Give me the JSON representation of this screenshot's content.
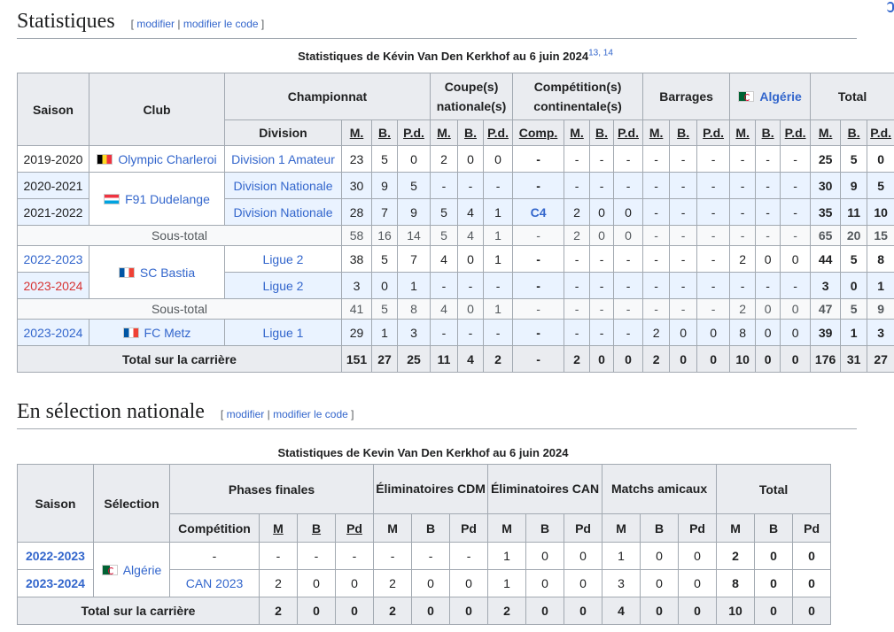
{
  "section1": {
    "heading": "Statistiques",
    "edit_open": "[",
    "edit1": "modifier",
    "edit_sep": "|",
    "edit2": "modifier le code",
    "edit_close": "]"
  },
  "club_caption": {
    "text": "Statistiques de Kévin Van Den Kerkhof au 6 juin 2024",
    "refs": "13, 14"
  },
  "club_table": {
    "h_saison": "Saison",
    "h_club": "Club",
    "h_championnat": "Championnat",
    "h_coupes": "Coupe(s) nationale(s)",
    "h_continent": "Compétition(s) continentale(s)",
    "h_barrages": "Barrages",
    "h_algerie": "Algérie",
    "h_total": "Total",
    "h_division": "Division",
    "h_m": "M.",
    "h_b": "B.",
    "h_pd": "P.d.",
    "h_comp": "Comp.",
    "rows": [
      {
        "saison": "2019-2020",
        "club": "Olympic Charleroi",
        "division": "Division 1 Amateur",
        "ch": [
          "23",
          "5",
          "0"
        ],
        "cp": [
          "2",
          "0",
          "0"
        ],
        "comp": "-",
        "ct": [
          "-",
          "-",
          "-"
        ],
        "br": [
          "-",
          "-",
          "-"
        ],
        "dz": [
          "-",
          "-",
          "-"
        ],
        "tot": [
          "25",
          "5",
          "0"
        ]
      },
      {
        "saison": "2020-2021",
        "club": "F91 Dudelange",
        "division": "Division Nationale",
        "ch": [
          "30",
          "9",
          "5"
        ],
        "cp": [
          "-",
          "-",
          "-"
        ],
        "comp": "-",
        "ct": [
          "-",
          "-",
          "-"
        ],
        "br": [
          "-",
          "-",
          "-"
        ],
        "dz": [
          "-",
          "-",
          "-"
        ],
        "tot": [
          "30",
          "9",
          "5"
        ]
      },
      {
        "saison": "2021-2022",
        "division": "Division Nationale",
        "ch": [
          "28",
          "7",
          "9"
        ],
        "cp": [
          "5",
          "4",
          "1"
        ],
        "comp": "C4",
        "ct": [
          "2",
          "0",
          "0"
        ],
        "br": [
          "-",
          "-",
          "-"
        ],
        "dz": [
          "-",
          "-",
          "-"
        ],
        "tot": [
          "35",
          "11",
          "10"
        ]
      },
      {
        "label": "Sous-total",
        "ch": [
          "58",
          "16",
          "14"
        ],
        "cp": [
          "5",
          "4",
          "1"
        ],
        "comp": "-",
        "ct": [
          "2",
          "0",
          "0"
        ],
        "br": [
          "-",
          "-",
          "-"
        ],
        "dz": [
          "-",
          "-",
          "-"
        ],
        "tot": [
          "65",
          "20",
          "15"
        ]
      },
      {
        "saison": "2022-2023",
        "club": "SC Bastia",
        "division": "Ligue 2",
        "ch": [
          "38",
          "5",
          "7"
        ],
        "cp": [
          "4",
          "0",
          "1"
        ],
        "comp": "-",
        "ct": [
          "-",
          "-",
          "-"
        ],
        "br": [
          "-",
          "-",
          "-"
        ],
        "dz": [
          "2",
          "0",
          "0"
        ],
        "tot": [
          "44",
          "5",
          "8"
        ]
      },
      {
        "saison": "2023-2024",
        "division": "Ligue 2",
        "ch": [
          "3",
          "0",
          "1"
        ],
        "cp": [
          "-",
          "-",
          "-"
        ],
        "comp": "-",
        "ct": [
          "-",
          "-",
          "-"
        ],
        "br": [
          "-",
          "-",
          "-"
        ],
        "dz": [
          "-",
          "-",
          "-"
        ],
        "tot": [
          "3",
          "0",
          "1"
        ]
      },
      {
        "label": "Sous-total",
        "ch": [
          "41",
          "5",
          "8"
        ],
        "cp": [
          "4",
          "0",
          "1"
        ],
        "comp": "-",
        "ct": [
          "-",
          "-",
          "-"
        ],
        "br": [
          "-",
          "-",
          "-"
        ],
        "dz": [
          "2",
          "0",
          "0"
        ],
        "tot": [
          "47",
          "5",
          "9"
        ]
      },
      {
        "saison": "2023-2024",
        "club": "FC Metz",
        "division": "Ligue 1",
        "ch": [
          "29",
          "1",
          "3"
        ],
        "cp": [
          "-",
          "-",
          "-"
        ],
        "comp": "-",
        "ct": [
          "-",
          "-",
          "-"
        ],
        "br": [
          "2",
          "0",
          "0"
        ],
        "dz": [
          "8",
          "0",
          "0"
        ],
        "tot": [
          "39",
          "1",
          "3"
        ]
      },
      {
        "label": "Total sur la carrière",
        "ch": [
          "151",
          "27",
          "25"
        ],
        "cp": [
          "11",
          "4",
          "2"
        ],
        "comp": "-",
        "ct": [
          "2",
          "0",
          "0"
        ],
        "br": [
          "2",
          "0",
          "0"
        ],
        "dz": [
          "10",
          "0",
          "0"
        ],
        "tot": [
          "176",
          "31",
          "27"
        ]
      }
    ]
  },
  "section2": {
    "heading": "En sélection nationale",
    "edit_open": "[",
    "edit1": "modifier",
    "edit_sep": "|",
    "edit2": "modifier le code",
    "edit_close": "]"
  },
  "nat_caption": {
    "text": "Statistiques de Kevin Van Den Kerkhof au 6 juin 2024"
  },
  "nat_table": {
    "h_saison": "Saison",
    "h_selection": "Sélection",
    "h_phases": "Phases finales",
    "h_elim_cdm": "Éliminatoires CDM",
    "h_elim_can": "Éliminatoires CAN",
    "h_amicaux": "Matchs amicaux",
    "h_total": "Total",
    "h_competition": "Compétition",
    "h_m": "M",
    "h_b": "B",
    "h_pd": "Pd",
    "selection": "Algérie",
    "rows": [
      {
        "saison": "2022-2023",
        "comp": "-",
        "pf": [
          "-",
          "-",
          "-"
        ],
        "cdm": [
          "-",
          "-",
          "-"
        ],
        "can": [
          "1",
          "0",
          "0"
        ],
        "am": [
          "1",
          "0",
          "0"
        ],
        "tot": [
          "2",
          "0",
          "0"
        ]
      },
      {
        "saison": "2023-2024",
        "comp": "CAN 2023",
        "pf": [
          "2",
          "0",
          "0"
        ],
        "cdm": [
          "2",
          "0",
          "0"
        ],
        "can": [
          "1",
          "0",
          "0"
        ],
        "am": [
          "3",
          "0",
          "0"
        ],
        "tot": [
          "8",
          "0",
          "0"
        ]
      },
      {
        "label": "Total sur la carrière",
        "pf": [
          "2",
          "0",
          "0"
        ],
        "cdm": [
          "2",
          "0",
          "0"
        ],
        "can": [
          "2",
          "0",
          "0"
        ],
        "am": [
          "4",
          "0",
          "0"
        ],
        "tot": [
          "10",
          "0",
          "0"
        ]
      }
    ]
  }
}
